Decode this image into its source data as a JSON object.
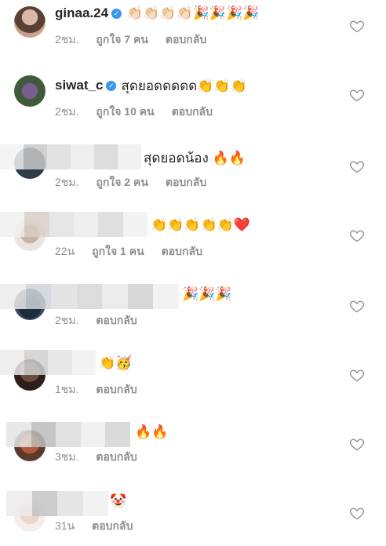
{
  "comments": [
    {
      "username": "ginaa.24",
      "verified": true,
      "text": "👏🏻👏🏻👏🏻👏🏻🎉🎉🎉🎉",
      "time": "2ชม.",
      "likes": "ถูกใจ 7 คน",
      "reply": "ตอบกลับ"
    },
    {
      "username": "siwat_c",
      "verified": true,
      "text": "สุดยอดดดดด👏👏👏",
      "time": "2ชม.",
      "likes": "ถูกใจ 10 คน",
      "reply": "ตอบกลับ"
    },
    {
      "username": "",
      "verified": false,
      "text": "สุดยอดน้อง 🔥🔥",
      "time": "2ชม.",
      "likes": "ถูกใจ 2 คน",
      "reply": "ตอบกลับ"
    },
    {
      "username": "",
      "verified": false,
      "text": "👏👏👏👏👏❤️",
      "time": "22น",
      "likes": "ถูกใจ 1 คน",
      "reply": "ตอบกลับ"
    },
    {
      "username": "",
      "verified": false,
      "text": "🎉🎉🎉",
      "time": "2ชม.",
      "likes": "",
      "reply": "ตอบกลับ"
    },
    {
      "username": "",
      "verified": false,
      "text": "👏🥳",
      "time": "1ชม.",
      "likes": "",
      "reply": "ตอบกลับ"
    },
    {
      "username": "",
      "verified": false,
      "text": "🔥🔥",
      "time": "3ชม.",
      "likes": "",
      "reply": "ตอบกลับ"
    },
    {
      "username": "",
      "verified": false,
      "text": "🤡",
      "time": "31น",
      "likes": "",
      "reply": "ตอบกลับ"
    }
  ],
  "colors": {
    "verified": "#3797f0",
    "meta": "#8e8e8e",
    "text": "#262626"
  },
  "icons": {
    "like": "heart-outline-icon",
    "verified": "verified-badge-icon"
  }
}
